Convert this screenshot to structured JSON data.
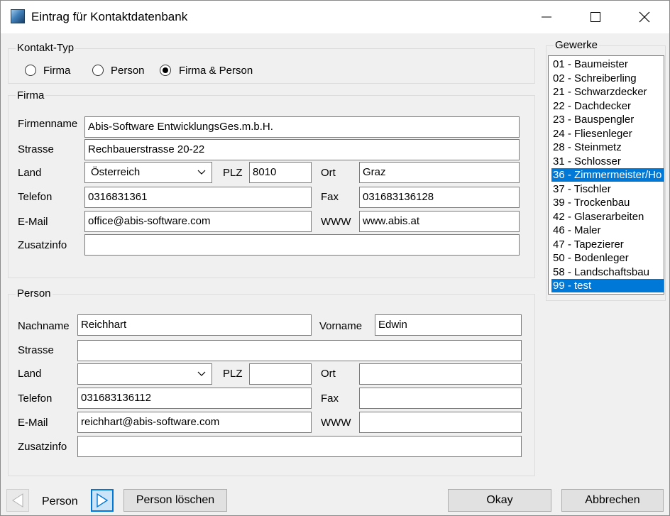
{
  "window": {
    "title": "Eintrag für Kontaktdatenbank"
  },
  "kontakt_typ": {
    "legend": "Kontakt-Typ",
    "options": [
      {
        "label": "Firma",
        "checked": false
      },
      {
        "label": "Person",
        "checked": false
      },
      {
        "label": "Firma & Person",
        "checked": true
      }
    ]
  },
  "firma": {
    "legend": "Firma",
    "labels": {
      "fimenname": "Firmenname",
      "strasse": "Strasse",
      "land": "Land",
      "plz": "PLZ",
      "ort": "Ort",
      "telefon": "Telefon",
      "fax": "Fax",
      "email": "E-Mail",
      "www": "WWW",
      "zusatzinfo": "Zusatzinfo"
    },
    "values": {
      "fimenname": "Abis-Software EntwicklungsGes.m.b.H.",
      "strasse": "Rechbauerstrasse 20-22",
      "land": "Österreich",
      "plz": "8010",
      "ort": "Graz",
      "telefon": "0316831361",
      "fax": "031683136128",
      "email": "office@abis-software.com",
      "www": "www.abis.at",
      "zusatzinfo": ""
    }
  },
  "person": {
    "legend": "Person",
    "labels": {
      "nachname": "Nachname",
      "vorname": "Vorname",
      "strasse": "Strasse",
      "land": "Land",
      "plz": "PLZ",
      "ort": "Ort",
      "telefon": "Telefon",
      "fax": "Fax",
      "email": "E-Mail",
      "www": "WWW",
      "zusatzinfo": "Zusatzinfo"
    },
    "values": {
      "nachname": "Reichhart",
      "vorname": "Edwin",
      "strasse": "",
      "land": "",
      "plz": "",
      "ort": "",
      "telefon": "031683136112",
      "fax": "",
      "email": "reichhart@abis-software.com",
      "www": "",
      "zusatzinfo": ""
    }
  },
  "gewerke": {
    "legend": "Gewerke",
    "items": [
      {
        "label": "01 - Baumeister",
        "selected": false
      },
      {
        "label": "02 - Schreiberling",
        "selected": false
      },
      {
        "label": "21 - Schwarzdecker",
        "selected": false
      },
      {
        "label": "22 - Dachdecker",
        "selected": false
      },
      {
        "label": "23 - Bauspengler",
        "selected": false
      },
      {
        "label": "24 - Fliesenleger",
        "selected": false
      },
      {
        "label": "28 - Steinmetz",
        "selected": false
      },
      {
        "label": "31 - Schlosser",
        "selected": false
      },
      {
        "label": "36 - Zimmermeister/Ho",
        "selected": true
      },
      {
        "label": "37 - Tischler",
        "selected": false
      },
      {
        "label": "39 - Trockenbau",
        "selected": false
      },
      {
        "label": "42 - Glaserarbeiten",
        "selected": false
      },
      {
        "label": "46 - Maler",
        "selected": false
      },
      {
        "label": "47 - Tapezierer",
        "selected": false
      },
      {
        "label": "50 - Bodenleger",
        "selected": false
      },
      {
        "label": "58 - Landschaftsbau",
        "selected": false
      },
      {
        "label": "99 - test",
        "selected": true
      }
    ]
  },
  "footer": {
    "person_label": "Person",
    "delete_person": "Person löschen",
    "okay": "Okay",
    "cancel": "Abbrechen"
  },
  "icons": {
    "prev": "triangle-left-icon",
    "next": "triangle-right-icon",
    "dropdown": "chevron-down-icon",
    "minimize": "minimize-icon",
    "maximize": "maximize-icon",
    "close": "close-icon"
  },
  "colors": {
    "selection": "#0078d7",
    "focus_border": "#0078d7",
    "next_button": "#cce4f7"
  }
}
